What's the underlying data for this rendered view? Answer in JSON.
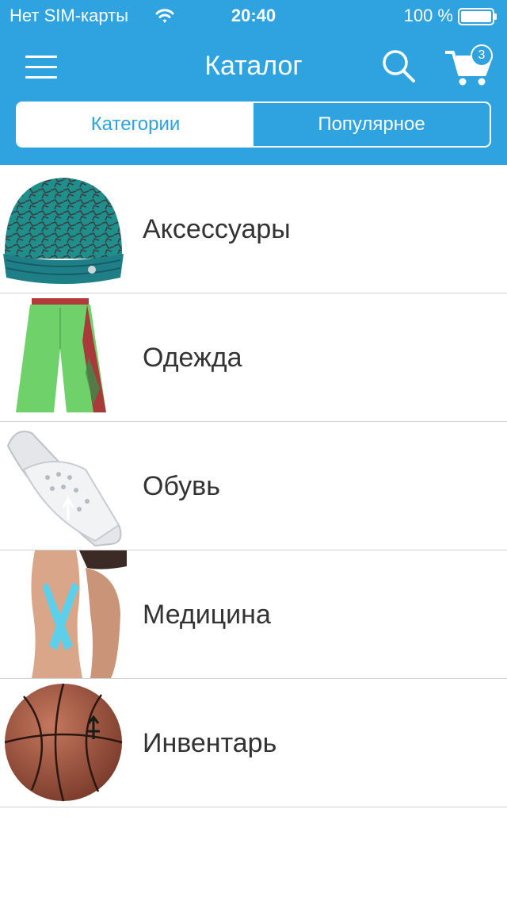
{
  "status_bar": {
    "carrier": "Нет SIM-карты",
    "time": "20:40",
    "battery": "100 %"
  },
  "nav": {
    "title": "Каталог",
    "cart_count": "3",
    "menu_icon": "hamburger-menu-icon",
    "search_icon": "search-icon",
    "cart_icon": "cart-icon"
  },
  "tabs": [
    {
      "label": "Категории",
      "active": true
    },
    {
      "label": "Популярное",
      "active": false
    }
  ],
  "categories": [
    {
      "label": "Аксессуары",
      "icon": "beanie-hat-image"
    },
    {
      "label": "Одежда",
      "icon": "green-shorts-image"
    },
    {
      "label": "Обувь",
      "icon": "slide-sandal-image"
    },
    {
      "label": "Медицина",
      "icon": "kinesiology-tape-knee-image"
    },
    {
      "label": "Инвентарь",
      "icon": "basketball-image"
    }
  ],
  "colors": {
    "accent": "#2ea3e0",
    "text": "#333333",
    "divider": "#d1d1d1",
    "background": "#ffffff"
  }
}
